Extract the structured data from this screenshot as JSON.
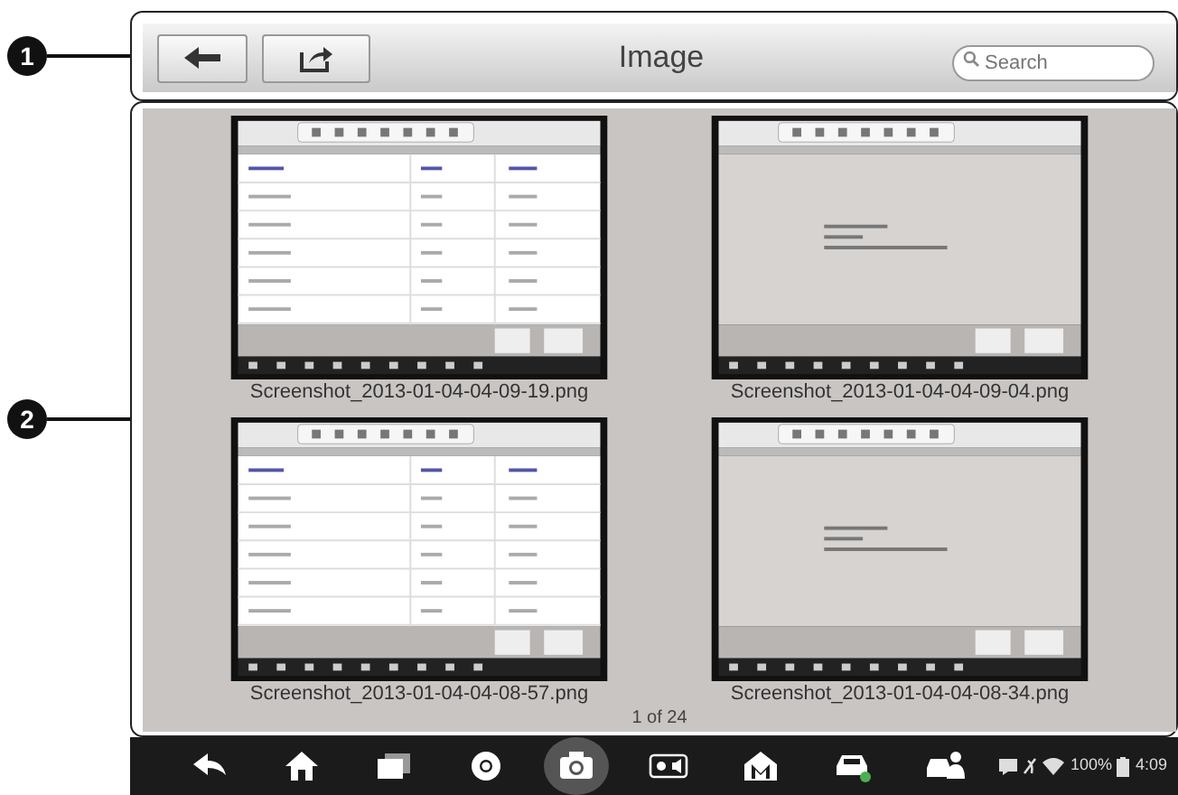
{
  "callouts": [
    "1",
    "2"
  ],
  "header": {
    "title": "Image",
    "search": {
      "placeholder": "Search"
    }
  },
  "thumbnails": [
    {
      "kind": "table",
      "filename": "Screenshot_2013-01-04-04-09-19.png"
    },
    {
      "kind": "dialog",
      "filename": "Screenshot_2013-01-04-04-09-04.png"
    },
    {
      "kind": "table",
      "filename": "Screenshot_2013-01-04-04-08-57.png"
    },
    {
      "kind": "dialog",
      "filename": "Screenshot_2013-01-04-04-08-34.png"
    }
  ],
  "pager": "1 of 24",
  "nav_buttons": [
    {
      "selected": false
    },
    {
      "selected": false
    },
    {
      "selected": false
    },
    {
      "selected": false
    },
    {
      "selected": true
    },
    {
      "selected": false
    },
    {
      "selected": false
    },
    {
      "selected": false
    },
    {
      "selected": false
    }
  ],
  "status_bar": {
    "battery": "100%",
    "time": "4:09"
  }
}
